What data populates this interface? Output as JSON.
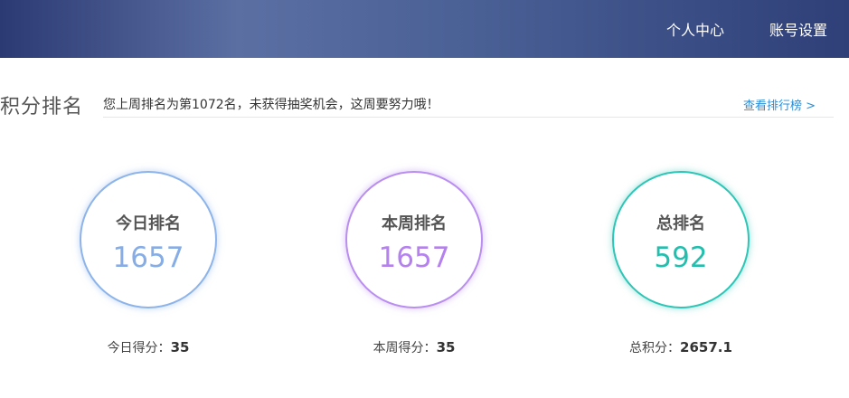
{
  "header": {
    "nav": [
      {
        "label": "个人中心"
      },
      {
        "label": "账号设置"
      }
    ]
  },
  "section": {
    "title": "积分排名",
    "notice": "您上周排名为第1072名，未获得抽奖机会，这周要努力哦！",
    "leaderboard_link": "查看排行榜 >"
  },
  "stats": [
    {
      "label": "今日排名",
      "value": "1657",
      "score_label": "今日得分：",
      "score_value": "35",
      "color": "#86ade6"
    },
    {
      "label": "本周排名",
      "value": "1657",
      "score_label": "本周得分：",
      "score_value": "35",
      "color": "#b481ee"
    },
    {
      "label": "总排名",
      "value": "592",
      "score_label": "总积分：",
      "score_value": "2657.1",
      "color": "#22bfae"
    }
  ]
}
